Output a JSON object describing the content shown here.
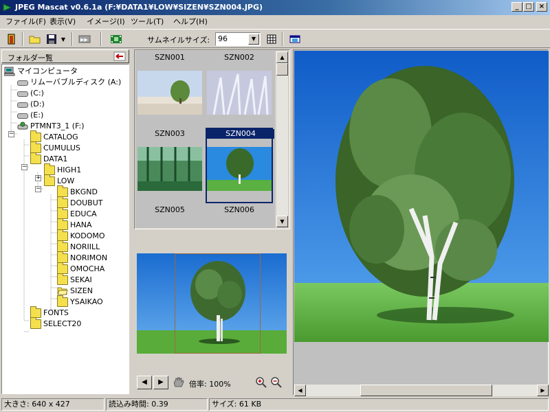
{
  "window": {
    "title": "JPEG Mascat v0.6.1a (F:¥DATA1¥LOW¥SIZEN¥SZN004.JPG)",
    "minimize": "_",
    "maximize": "□",
    "close": "×"
  },
  "menu": [
    {
      "label": "ファイル(F)"
    },
    {
      "label": "表示(V)"
    },
    {
      "label": "イメージ(I)"
    },
    {
      "label": "ツール(T)"
    },
    {
      "label": "ヘルプ(H)"
    }
  ],
  "toolbar": {
    "thumbnail_size_label": "サムネイルサイズ:",
    "thumbnail_size_value": "96"
  },
  "folder_pane": {
    "title": "フォルダ一覧",
    "tree": [
      {
        "label": "マイコンピュータ",
        "icon": "computer-icon",
        "indent": 0
      },
      {
        "label": "リムーバブルディスク (A:)",
        "icon": "drive-icon",
        "indent": 1
      },
      {
        "label": "(C:)",
        "icon": "drive-icon",
        "indent": 1
      },
      {
        "label": "(D:)",
        "icon": "drive-icon",
        "indent": 1
      },
      {
        "label": "(E:)",
        "icon": "drive-icon",
        "indent": 1
      },
      {
        "label": "PTMNT3_1 (F:)",
        "icon": "network-drive-icon",
        "indent": 1
      },
      {
        "label": "CATALOG",
        "icon": "folder-icon",
        "indent": 2
      },
      {
        "label": "CUMULUS",
        "icon": "folder-icon",
        "indent": 2
      },
      {
        "label": "DATA1",
        "icon": "folder-icon",
        "indent": 2
      },
      {
        "label": "HIGH1",
        "icon": "folder-icon",
        "indent": 3
      },
      {
        "label": "LOW",
        "icon": "folder-icon",
        "indent": 3
      },
      {
        "label": "BKGND",
        "icon": "folder-icon",
        "indent": 4
      },
      {
        "label": "DOUBUT",
        "icon": "folder-icon",
        "indent": 4
      },
      {
        "label": "EDUCA",
        "icon": "folder-icon",
        "indent": 4
      },
      {
        "label": "HANA",
        "icon": "folder-icon",
        "indent": 4
      },
      {
        "label": "KODOMO",
        "icon": "folder-icon",
        "indent": 4
      },
      {
        "label": "NORIILL",
        "icon": "folder-icon",
        "indent": 4
      },
      {
        "label": "NORIMON",
        "icon": "folder-icon",
        "indent": 4
      },
      {
        "label": "OMOCHA",
        "icon": "folder-icon",
        "indent": 4
      },
      {
        "label": "SEKAI",
        "icon": "folder-icon",
        "indent": 4
      },
      {
        "label": "SIZEN",
        "icon": "open-folder-icon",
        "indent": 4
      },
      {
        "label": "YSAIKAO",
        "icon": "folder-icon",
        "indent": 4
      },
      {
        "label": "FONTS",
        "icon": "folder-icon",
        "indent": 2
      },
      {
        "label": "SELECT20",
        "icon": "folder-icon",
        "indent": 2
      }
    ]
  },
  "thumbnails": [
    {
      "name": "SZN001",
      "selected": false
    },
    {
      "name": "SZN002",
      "selected": false
    },
    {
      "name": "SZN003",
      "selected": false
    },
    {
      "name": "SZN004",
      "selected": true
    },
    {
      "name": "SZN005",
      "selected": false
    },
    {
      "name": "SZN006",
      "selected": false
    }
  ],
  "preview": {
    "zoom_label": "倍率: 100%"
  },
  "status": {
    "size": "大きさ: 640 x 427",
    "load_time": "読込み時間: 0.39",
    "file_size": "サイズ: 61 KB"
  }
}
